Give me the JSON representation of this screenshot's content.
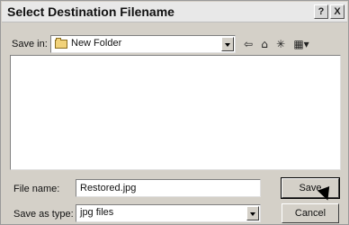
{
  "window": {
    "title": "Select Destination Filename",
    "help_label": "?",
    "close_label": "X"
  },
  "toolbar": {
    "save_in_label": "Save in:",
    "save_in_value": "New Folder",
    "back_icon": "arrow-left-icon",
    "up_icon": "folder-up-icon",
    "new_folder_icon": "new-folder-icon",
    "view_menu_icon": "view-menu-icon"
  },
  "file_list": {
    "items": []
  },
  "form": {
    "file_name_label": "File name:",
    "file_name_value": "Restored.jpg",
    "save_as_type_label": "Save as type:",
    "save_as_type_value": "jpg files"
  },
  "buttons": {
    "save_label": "Save",
    "cancel_label": "Cancel"
  }
}
